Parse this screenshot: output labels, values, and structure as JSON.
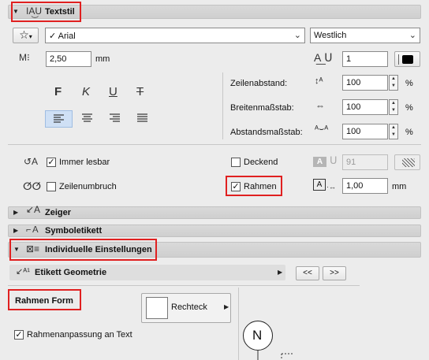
{
  "textstil": {
    "title": "Textstil",
    "font": "Arial",
    "script": "Westlich",
    "text_size": "2,50",
    "text_size_unit": "mm",
    "pen_number": "1",
    "style_buttons": [
      "F",
      "K",
      "U",
      "T"
    ],
    "zeilenabstand_label": "Zeilenabstand:",
    "zeilenabstand_value": "100",
    "breitenmassstab_label": "Breitenmaßstab:",
    "breitenmassstab_value": "100",
    "abstandsmassstab_label": "Abstandsmaßstab:",
    "abstandsmassstab_value": "100",
    "percent": "%",
    "immer_lesbar": "Immer lesbar",
    "zeilenumbruch": "Zeilenumbruch",
    "deckend": "Deckend",
    "rahmen": "Rahmen",
    "fill_pen": "91",
    "frame_offset": "1,00",
    "frame_offset_unit": "mm"
  },
  "sections": {
    "zeiger": "Zeiger",
    "symboletikett": "Symboletikett",
    "individuelle": "Individuelle Einstellungen"
  },
  "individuelle": {
    "etikett_geometrie": "Etikett Geometrie",
    "prev": "<<",
    "next": ">>",
    "rahmen_form_label": "Rahmen Form",
    "rahmen_form_value": "Rechteck",
    "rahmenanpassung": "Rahmenanpassung an Text",
    "preview_letter": "N"
  },
  "colors": {
    "highlight": "#e02020",
    "active_align": "#cfe0f5"
  }
}
